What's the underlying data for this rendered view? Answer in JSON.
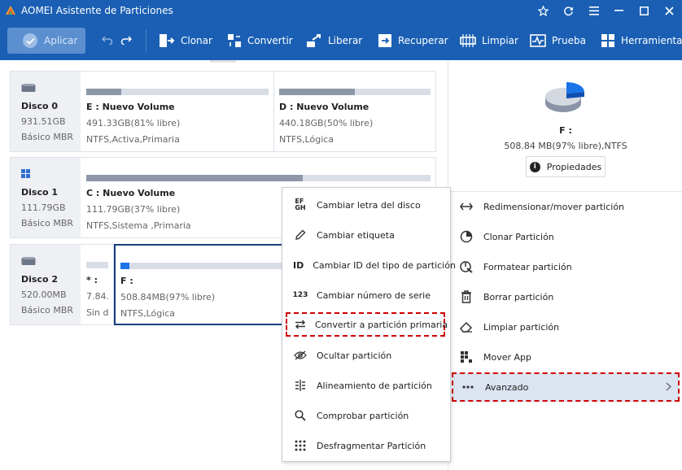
{
  "window": {
    "title": "AOMEI Asistente de Particiones"
  },
  "toolbar": {
    "apply_label": "Aplicar",
    "tools": [
      {
        "label": "Clonar",
        "icon": "clone-icon"
      },
      {
        "label": "Convertir",
        "icon": "convert-icon"
      },
      {
        "label": "Liberar",
        "icon": "free-icon"
      },
      {
        "label": "Recuperar",
        "icon": "recover-icon"
      },
      {
        "label": "Limpiar",
        "icon": "wipe-icon"
      },
      {
        "label": "Prueba",
        "icon": "test-icon"
      },
      {
        "label": "Herramientas",
        "icon": "tools-icon"
      }
    ]
  },
  "disks": [
    {
      "name": "Disco 0",
      "size": "931.51GB",
      "type": "Básico MBR",
      "partitions": [
        {
          "name": "E : Nuevo Volume",
          "usage": "491.33GB(81% libre)",
          "fs": "NTFS,Activa,Primaria",
          "used": 0.19
        },
        {
          "name": "D : Nuevo Volume",
          "usage": "440.18GB(50% libre)",
          "fs": "NTFS,Lógica",
          "used": 0.5
        }
      ]
    },
    {
      "name": "Disco 1",
      "size": "111.79GB",
      "type": "Básico MBR",
      "partitions": [
        {
          "name": "C : Nuevo Volume",
          "usage": "111.79GB(37% libre)",
          "fs": "NTFS,Sistema ,Primaria",
          "used": 0.63
        }
      ]
    },
    {
      "name": "Disco 2",
      "size": "520.00MB",
      "type": "Básico MBR",
      "partitions": [
        {
          "name": "* :",
          "usage": "7.84...",
          "fs": "Sin d...",
          "used": 0
        },
        {
          "name": "F :",
          "usage": "508.84MB(97% libre)",
          "fs": "NTFS,Lógica",
          "used": 0.03
        }
      ]
    }
  ],
  "context_menu": [
    {
      "label": "Cambiar letra del disco",
      "glyph": "EF GH"
    },
    {
      "label": "Cambiar etiqueta",
      "icon": "pencil-icon"
    },
    {
      "label": "Cambiar ID del tipo de partición",
      "glyph": "ID"
    },
    {
      "label": "Cambiar número de serie",
      "glyph": "123"
    },
    {
      "label": "Convertir a partición primaria",
      "icon": "swap-arrows-icon",
      "highlighted": true
    },
    {
      "label": "Ocultar partición",
      "icon": "hide-eye-icon"
    },
    {
      "label": "Alineamiento de partición",
      "icon": "align-icon"
    },
    {
      "label": "Comprobar partición",
      "icon": "search-icon"
    },
    {
      "label": "Desfragmentar Partición",
      "icon": "defrag-icon"
    }
  ],
  "right_panel": {
    "partition_label": "F :",
    "partition_info": "508.84 MB(97% libre),NTFS",
    "properties_label": "Propiedades",
    "operations": [
      {
        "label": "Redimensionar/mover partición",
        "icon": "resize-icon"
      },
      {
        "label": "Clonar Partición",
        "icon": "clone-partition-icon"
      },
      {
        "label": "Formatear partición",
        "icon": "format-icon"
      },
      {
        "label": "Borrar partición",
        "icon": "trash-icon"
      },
      {
        "label": "Limpiar partición",
        "icon": "eraser-icon"
      },
      {
        "label": "Mover App",
        "icon": "move-app-icon"
      },
      {
        "label": "Avanzado",
        "icon": "more-icon",
        "highlighted": true
      }
    ]
  },
  "colors": {
    "accent": "#1a5fb4",
    "highlight": "#d00000",
    "used_bar": "#8c97a8",
    "selected_fill": "#1a73e8"
  }
}
